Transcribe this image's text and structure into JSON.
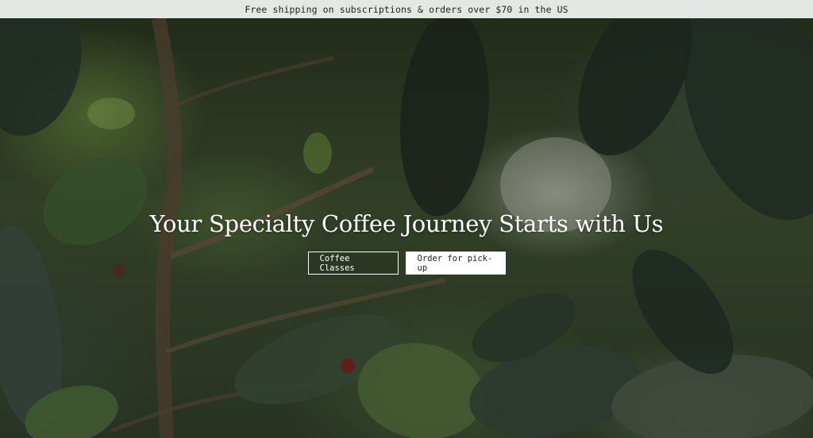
{
  "announcement": {
    "text": "Free shipping on subscriptions & orders over $70 in the US"
  },
  "hero": {
    "title": "Your Specialty Coffee Journey Starts with Us",
    "buttons": {
      "classes_label": "Coffee Classes",
      "pickup_label": "Order for pick-up"
    }
  },
  "colors": {
    "announcement_bg": "#e4e8e4",
    "announcement_text": "#1d1f1d",
    "button_outline": "#ffffff",
    "button_solid_bg": "#ffffff",
    "button_solid_text": "#1b1d1b"
  }
}
